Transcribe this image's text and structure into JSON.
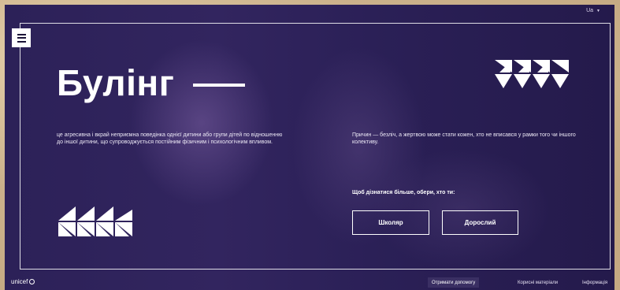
{
  "header": {
    "language": "Ua"
  },
  "hero": {
    "title": "Булінг",
    "left_text": "це агресивна і вкрай неприємна поведінка однієї дитини або групи дітей по відношенню до іншої дитини, що супроводжується постійним фізичним і психологічним впливом.",
    "right_text": "Причин — безліч, а жертвою може стати кожен, хто не вписався у рамки того чи іншого колективу.",
    "prompt": "Щоб дізнатися більше, обери, хто ти:",
    "buttons": {
      "pupil": "Школяр",
      "adult": "Дорослий"
    }
  },
  "footer": {
    "logo": "unicef",
    "help": "Отримати допомогу",
    "materials": "Корисні матеріали",
    "info": "Інформація"
  },
  "icons": {
    "menu": "hamburger-icon",
    "language_caret": "chevron-down-icon",
    "decor": "triangle-pattern-icon"
  },
  "colors": {
    "background": "#2a1f52",
    "accent": "#ffffff",
    "frame": "#cdb48e"
  }
}
